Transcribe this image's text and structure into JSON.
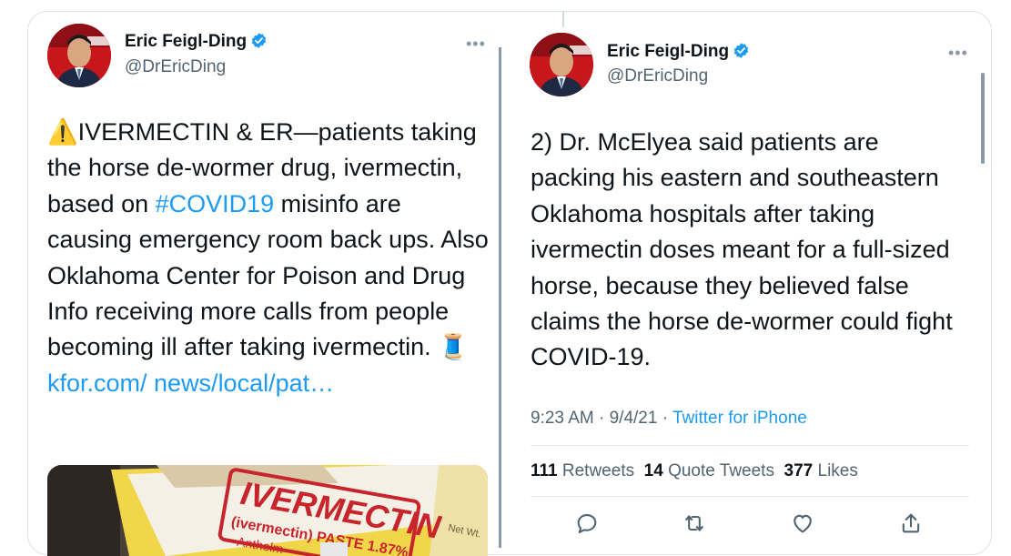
{
  "left_tweet": {
    "author_name": "Eric Feigl-Ding",
    "author_handle": "@DrEricDing",
    "more_label": "•••",
    "warning_emoji": "⚠️",
    "text_part1": "IVERMECTIN & ER—patients taking the horse de-wormer drug, ivermectin, based on ",
    "hashtag": "#COVID19",
    "text_part2": " misinfo are causing emergency room back ups. Also Oklahoma Center for Poison and Drug Info receiving more calls from people becoming ill after taking ivermectin. ",
    "thread_emoji": "🧵",
    "link_text": " kfor.com/ news/local/pat…",
    "media": {
      "brand": "IVERMECTIN",
      "subtext": "(ivermectin) PASTE 1.87%",
      "line3": "Anthelm",
      "corner_text": "Net Wt."
    }
  },
  "right_tweet": {
    "author_name": "Eric Feigl-Ding",
    "author_handle": "@DrEricDing",
    "more_label": "•••",
    "text": "2) Dr. McElyea said patients are packing his eastern and southeastern Oklahoma hospitals after taking ivermectin doses meant for a full-sized horse, because they believed false claims the horse de-wormer could fight COVID-19.",
    "time": "9:23 AM",
    "date": "9/4/21",
    "source": "Twitter for iPhone",
    "retweets_count": "111",
    "retweets_label": "Retweets",
    "quotes_count": "14",
    "quotes_label": "Quote Tweets",
    "likes_count": "377",
    "likes_label": "Likes"
  },
  "colors": {
    "accent": "#1d9bf0",
    "text": "#0f1419",
    "secondary": "#536471",
    "border": "#d9e1e8"
  }
}
